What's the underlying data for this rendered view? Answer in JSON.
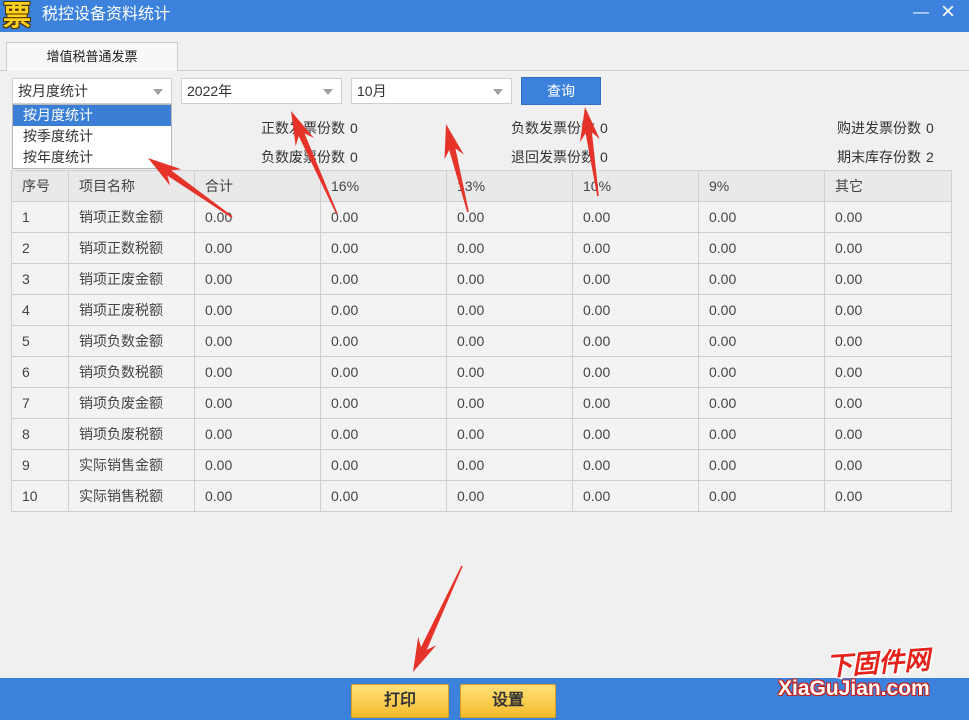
{
  "window": {
    "icon_glyph": "票",
    "icon": "app-icon",
    "title": "税控设备资料统计",
    "minimize": "—",
    "close": "×"
  },
  "tabs": [
    {
      "label": "增值税普通发票",
      "active": true
    }
  ],
  "filters": {
    "stat_mode": {
      "selected": "按月度统计",
      "expanded": true,
      "options": [
        {
          "label": "按月度统计",
          "highlighted": true
        },
        {
          "label": "按季度统计",
          "highlighted": false
        },
        {
          "label": "按年度统计",
          "highlighted": false
        }
      ]
    },
    "year": {
      "selected": "2022年"
    },
    "month": {
      "selected": "10月"
    },
    "query_button": "查询"
  },
  "summary": {
    "positive_invoices": {
      "label": "正数发票份数",
      "value": "0"
    },
    "negative_invoices": {
      "label": "负数发票份数",
      "value": "0"
    },
    "purchased_invoices": {
      "label": "购进发票份数",
      "value": "0"
    },
    "negative_void_invoices": {
      "label": "负数废票份数",
      "value": "0"
    },
    "returned_invoices": {
      "label": "退回发票份数",
      "value": "0"
    },
    "ending_stock": {
      "label": "期末库存份数",
      "value": "2"
    }
  },
  "table": {
    "headers": {
      "seq": "序号",
      "item": "项目名称",
      "total": "合计",
      "r16": "16%",
      "r13": "13%",
      "r10": "10%",
      "r9": "9%",
      "other": "其它"
    },
    "rows": [
      {
        "seq": "1",
        "item": "销项正数金额",
        "total": "0.00",
        "r16": "0.00",
        "r13": "0.00",
        "r10": "0.00",
        "r9": "0.00",
        "other": "0.00"
      },
      {
        "seq": "2",
        "item": "销项正数税额",
        "total": "0.00",
        "r16": "0.00",
        "r13": "0.00",
        "r10": "0.00",
        "r9": "0.00",
        "other": "0.00"
      },
      {
        "seq": "3",
        "item": "销项正废金额",
        "total": "0.00",
        "r16": "0.00",
        "r13": "0.00",
        "r10": "0.00",
        "r9": "0.00",
        "other": "0.00"
      },
      {
        "seq": "4",
        "item": "销项正废税额",
        "total": "0.00",
        "r16": "0.00",
        "r13": "0.00",
        "r10": "0.00",
        "r9": "0.00",
        "other": "0.00"
      },
      {
        "seq": "5",
        "item": "销项负数金额",
        "total": "0.00",
        "r16": "0.00",
        "r13": "0.00",
        "r10": "0.00",
        "r9": "0.00",
        "other": "0.00"
      },
      {
        "seq": "6",
        "item": "销项负数税额",
        "total": "0.00",
        "r16": "0.00",
        "r13": "0.00",
        "r10": "0.00",
        "r9": "0.00",
        "other": "0.00"
      },
      {
        "seq": "7",
        "item": "销项负废金额",
        "total": "0.00",
        "r16": "0.00",
        "r13": "0.00",
        "r10": "0.00",
        "r9": "0.00",
        "other": "0.00"
      },
      {
        "seq": "8",
        "item": "销项负废税额",
        "total": "0.00",
        "r16": "0.00",
        "r13": "0.00",
        "r10": "0.00",
        "r9": "0.00",
        "other": "0.00"
      },
      {
        "seq": "9",
        "item": "实际销售金额",
        "total": "0.00",
        "r16": "0.00",
        "r13": "0.00",
        "r10": "0.00",
        "r9": "0.00",
        "other": "0.00"
      },
      {
        "seq": "10",
        "item": "实际销售税额",
        "total": "0.00",
        "r16": "0.00",
        "r13": "0.00",
        "r10": "0.00",
        "r9": "0.00",
        "other": "0.00"
      }
    ]
  },
  "footer": {
    "print": "打印",
    "settings": "设置"
  },
  "watermark": {
    "cn": "下固件网",
    "domain": "XiaGuJian.com"
  },
  "colors": {
    "titlebar": "#3c82dc",
    "accent": "#3c82dc",
    "selection": "#3a7fd5",
    "button_gold": "#f4bb2a",
    "annotation_arrow": "#e5332a",
    "watermark_red": "#e3231c"
  }
}
